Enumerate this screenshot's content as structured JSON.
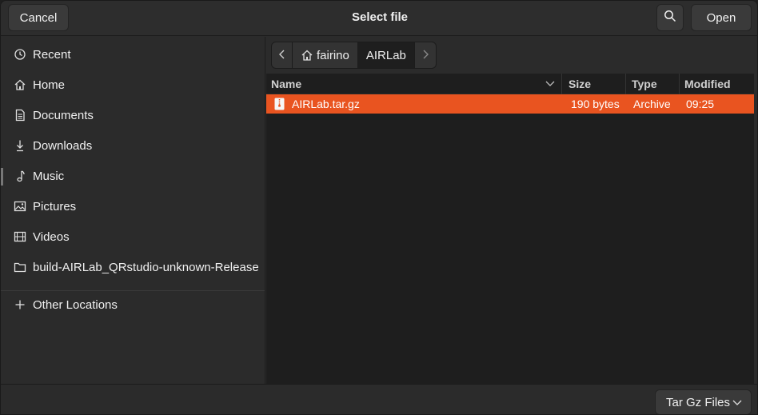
{
  "header": {
    "title": "Select file",
    "cancel_label": "Cancel",
    "open_label": "Open",
    "search_icon": "search-icon"
  },
  "sidebar": {
    "items": [
      {
        "label": "Recent",
        "icon": "clock-icon"
      },
      {
        "label": "Home",
        "icon": "home-icon"
      },
      {
        "label": "Documents",
        "icon": "document-icon"
      },
      {
        "label": "Downloads",
        "icon": "download-icon"
      },
      {
        "label": "Music",
        "icon": "music-icon"
      },
      {
        "label": "Pictures",
        "icon": "picture-icon"
      },
      {
        "label": "Videos",
        "icon": "video-icon"
      },
      {
        "label": "build-AIRLab_QRstudio-unknown-Release",
        "icon": "folder-icon"
      }
    ],
    "other_locations": {
      "label": "Other Locations",
      "icon": "plus-icon"
    }
  },
  "pathbar": {
    "segments": [
      {
        "label": "fairino",
        "icon": "home-icon"
      },
      {
        "label": "AIRLab"
      }
    ]
  },
  "columns": {
    "name": "Name",
    "size": "Size",
    "type": "Type",
    "modified": "Modified"
  },
  "files": [
    {
      "name": "AIRLab.tar.gz",
      "size": "190 bytes",
      "type": "Archive",
      "modified": "09:25",
      "selected": true
    }
  ],
  "footer": {
    "filter_label": "Tar Gz Files"
  },
  "colors": {
    "accent": "#e95420",
    "background": "#2b2b2b",
    "list_background": "#1e1e1e"
  }
}
